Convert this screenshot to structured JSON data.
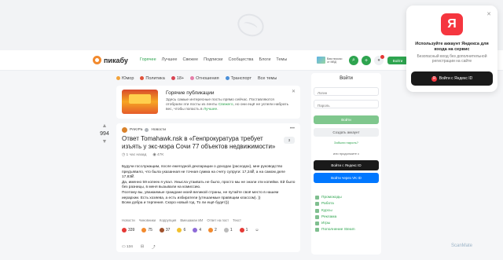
{
  "header": {
    "logo_text": "пикабу",
    "nav": [
      "Горячее",
      "Лучшее",
      "Свежее",
      "Подписки",
      "Сообщества",
      "Блоги",
      "Темы"
    ],
    "promo_text": "Вам письмо от МВД",
    "login_label": "Войти"
  },
  "tags": [
    {
      "label": "Юмор",
      "color": "#f2a23a"
    },
    {
      "label": "Политика",
      "color": "#e0533b"
    },
    {
      "label": "18+",
      "color": "#d94452"
    },
    {
      "label": "Отношения",
      "color": "#e57ea8"
    },
    {
      "label": "Транспорт",
      "color": "#4a8fd8"
    },
    {
      "label": "Все темы",
      "color": ""
    }
  ],
  "hot": {
    "title": "Горячие публикации",
    "text_prefix": "Здесь самые интересные посты прямо сейчас. Поставляются отобрали эти посты из ленты ",
    "link1": "Свежего",
    "text_middle": ", но они ещё не успели набрать вес, чтобы попасть в ",
    "link2": "Лучшее",
    "text_suffix": "."
  },
  "post": {
    "votes": "994",
    "author": "PAKIPa",
    "section": "Новости",
    "title": "Ответ Tomahawk.nsk в «Генпрокуратура требует изъять у экс-мэра Сочи 77 объектов недвижимости»",
    "badge": "3",
    "time": "1 час назад",
    "views": "47K",
    "body": [
      "Будучи госслужащим, после ежегодной декларации о доходах (расходах), мне руководство предъявило, что была указанная не точная сумма на счету супруги: 17,24₽, а на самом деле 17,83₽.",
      "Да, именно 59 копеек я упал. Умысла утаивать не было, просто мы не знали эти копейки. Ей было без разницы, в меня вызывали на комиссию.",
      "Поэтому вы, уважаемые граждане моей великой страны, не путайте своё место в нашем иерархии. Есть хозяева, а есть избиратели (утешаемые правящим классом). ))",
      "Всем добра и терпения. Скоро новый год. То ли ещё будет)))"
    ],
    "tags": [
      "Новости",
      "Чиновники",
      "Коррупция",
      "Вмешаман ИИ",
      "Ответ на пост",
      "Текст"
    ],
    "reactions": [
      {
        "count": "339",
        "color": "#e53935"
      },
      {
        "count": "75",
        "color": "#f28a2e"
      },
      {
        "count": "37",
        "color": "#a0522d"
      },
      {
        "count": "6",
        "color": "#f2c12e"
      },
      {
        "count": "4",
        "color": "#8e6bd8"
      },
      {
        "count": "2",
        "color": "#f28a2e"
      },
      {
        "count": "1",
        "color": "#bbbbbb"
      },
      {
        "count": "1",
        "color": "#e53935"
      }
    ],
    "comments": "134"
  },
  "auth": {
    "title": "Войти",
    "login_placeholder": "Логин",
    "password_placeholder": "Пароль",
    "login_btn": "Войти",
    "register_btn": "Создать аккаунт",
    "forgot": "Забыли пароль?",
    "or": "или продолжите с",
    "yandex_btn": "Войти с Яндекс ID",
    "vk_btn": "Войти через VK ID"
  },
  "sidebar_links": [
    "Промокоды",
    "Работа",
    "Курсы",
    "Реклама",
    "Игры",
    "Пополнение Steam"
  ],
  "yandex_popup": {
    "logo": "Я",
    "title": "Используйте аккаунт Яндекса для входа на сервис",
    "subtitle": "Безопасный вход без дополнительной регистрации на сайте",
    "button": "Войти с Яндекс ID",
    "btn_icon": "Я"
  },
  "watermark": "ScanMate"
}
